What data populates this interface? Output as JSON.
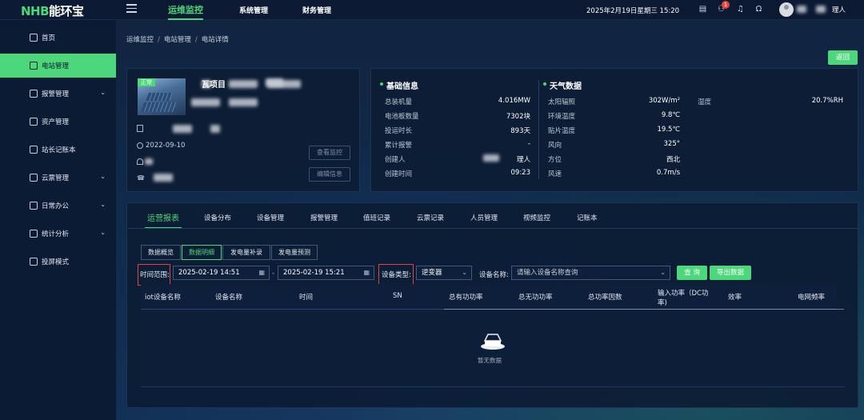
{
  "app": {
    "logo_mark": "NHB",
    "logo_name": "能环宝"
  },
  "topbar": {
    "tabs": [
      {
        "label": "运维监控",
        "active": true
      },
      {
        "label": "系统管理",
        "active": false
      },
      {
        "label": "财务管理",
        "active": false
      }
    ],
    "datetime": "2025年2月19日星期三 15:20",
    "notification_count": "1",
    "user_name_suffix": "理人",
    "icons": [
      "document-icon",
      "network-icon",
      "bell-icon",
      "headset-icon"
    ]
  },
  "sidebar": {
    "items": [
      {
        "label": "首页",
        "icon": "home-icon",
        "active": false,
        "expandable": false
      },
      {
        "label": "电站管理",
        "icon": "station-icon",
        "active": true,
        "expandable": false
      },
      {
        "label": "报警管理",
        "icon": "alarm-icon",
        "active": false,
        "expandable": true
      },
      {
        "label": "资产管理",
        "icon": "asset-icon",
        "active": false,
        "expandable": false
      },
      {
        "label": "站长记账本",
        "icon": "ledger-icon",
        "active": false,
        "expandable": false
      },
      {
        "label": "云票管理",
        "icon": "ticket-icon",
        "active": false,
        "expandable": true
      },
      {
        "label": "日常办公",
        "icon": "office-icon",
        "active": false,
        "expandable": true
      },
      {
        "label": "统计分析",
        "icon": "stats-icon",
        "active": false,
        "expandable": true
      },
      {
        "label": "投屏模式",
        "icon": "screen-icon",
        "active": false,
        "expandable": false
      }
    ]
  },
  "breadcrumb": [
    "运维监控",
    "电站管理",
    "电站详情"
  ],
  "back_label": "返回",
  "station": {
    "tag": "正常",
    "title_suffix": "瓦项目",
    "date": "2022-09-10",
    "view_monitor": "查看监控",
    "edit_info": "编辑信息"
  },
  "basic_info": {
    "title": "基础信息",
    "rows": [
      {
        "label": "总装机量",
        "value": "4.016MW"
      },
      {
        "label": "电池板数量",
        "value": "7302块"
      },
      {
        "label": "投运时长",
        "value": "893天"
      },
      {
        "label": "累计报警",
        "value": "-"
      },
      {
        "label": "创建人",
        "value": "理人"
      },
      {
        "label": "创建时间",
        "value": "09:23"
      }
    ]
  },
  "weather": {
    "title": "天气数据",
    "rows": [
      {
        "label": "太阳辐照",
        "value": "302W/m²"
      },
      {
        "label": "环境温度",
        "value": "9.8℃"
      },
      {
        "label": "贴片温度",
        "value": "19.5℃"
      },
      {
        "label": "风向",
        "value": "325°"
      },
      {
        "label": "方位",
        "value": "西北"
      },
      {
        "label": "风速",
        "value": "0.7m/s"
      }
    ],
    "humidity_label": "湿度",
    "humidity_value": "20.7%RH"
  },
  "tabs": [
    {
      "label": "运营报表",
      "active": true
    },
    {
      "label": "设备分布",
      "active": false
    },
    {
      "label": "设备管理",
      "active": false
    },
    {
      "label": "报警管理",
      "active": false
    },
    {
      "label": "值班记录",
      "active": false
    },
    {
      "label": "云票记录",
      "active": false
    },
    {
      "label": "人员管理",
      "active": false
    },
    {
      "label": "视频监控",
      "active": false
    },
    {
      "label": "记账本",
      "active": false
    }
  ],
  "sub_tabs": [
    {
      "label": "数据概览",
      "active": false
    },
    {
      "label": "数据明细",
      "active": true
    },
    {
      "label": "发电量补录",
      "active": false
    },
    {
      "label": "发电量预测",
      "active": false
    }
  ],
  "filters": {
    "time_label": "时间范围:",
    "start_time": "2025-02-19 14:51",
    "end_time": "2025-02-19 15:21",
    "range_sep": "-",
    "device_type_label": "设备类型:",
    "device_type_value": "逆变器",
    "device_name_label": "设备名称:",
    "device_name_placeholder": "请输入设备名称查询",
    "query_btn": "查 询",
    "export_btn": "导出数据"
  },
  "table": {
    "columns": [
      "iot设备名称",
      "设备名称",
      "时间",
      "SN",
      "总有功功率",
      "总无功功率",
      "总功率因数",
      "输入功率（DC功",
      "率)",
      "效率",
      "电网频率"
    ],
    "rows": [],
    "empty_text": "暂无数据"
  },
  "colors": {
    "accent": "#4cd77a",
    "highlight_border": "#e24444",
    "background": "#0a1830"
  }
}
